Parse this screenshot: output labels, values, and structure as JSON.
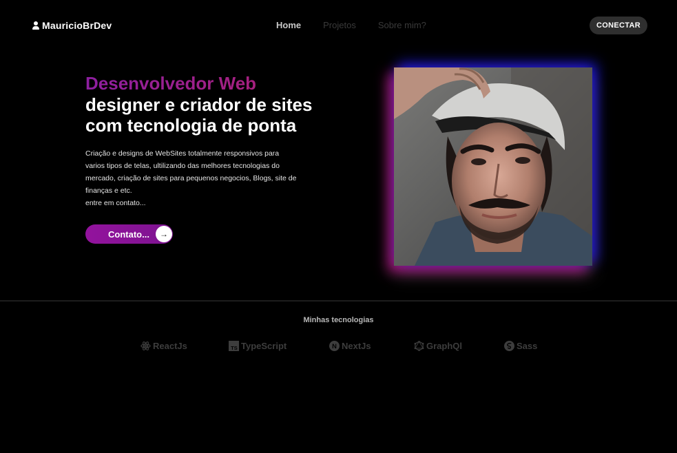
{
  "header": {
    "logo_text": "MauricioBrDev",
    "logo_icon": "user-icon",
    "nav": [
      {
        "label": "Home",
        "active": true
      },
      {
        "label": "Projetos",
        "active": false
      },
      {
        "label": "Sobre mim?",
        "active": false
      }
    ],
    "connect_label": "CONECTAR"
  },
  "hero": {
    "accent_title": "Desenvolvedor Web",
    "title_line_1": "designer e criador de sites",
    "title_line_2": "com tecnologia de ponta",
    "description": [
      "Criação e designs de WebSites totalmente responsivos para",
      "varios tipos de telas, ultilizando das melhores tecnologias do",
      "mercado, criação de sites para pequenos negocios, Blogs, site de",
      "finanças e etc.",
      "entre em contato..."
    ],
    "contact_label": "Contato...",
    "contact_icon": "arrow-right-icon"
  },
  "photo": {
    "alt": "profile-photo",
    "glow_colors": [
      "#1a1ad8",
      "#b0157a"
    ]
  },
  "technologies": {
    "title": "Minhas tecnologias",
    "items": [
      {
        "label": "ReactJs",
        "icon": "react-icon"
      },
      {
        "label": "TypeScript",
        "icon": "typescript-icon"
      },
      {
        "label": "NextJs",
        "icon": "nextjs-icon"
      },
      {
        "label": "GraphQl",
        "icon": "graphql-icon"
      },
      {
        "label": "Sass",
        "icon": "sass-icon"
      }
    ]
  },
  "colors": {
    "background": "#000000",
    "accent_gradient": [
      "#8d1fa0",
      "#b5216a"
    ],
    "button_gradient": [
      "#93139d",
      "#7d1390"
    ],
    "muted_text": "#3d3d3d"
  }
}
